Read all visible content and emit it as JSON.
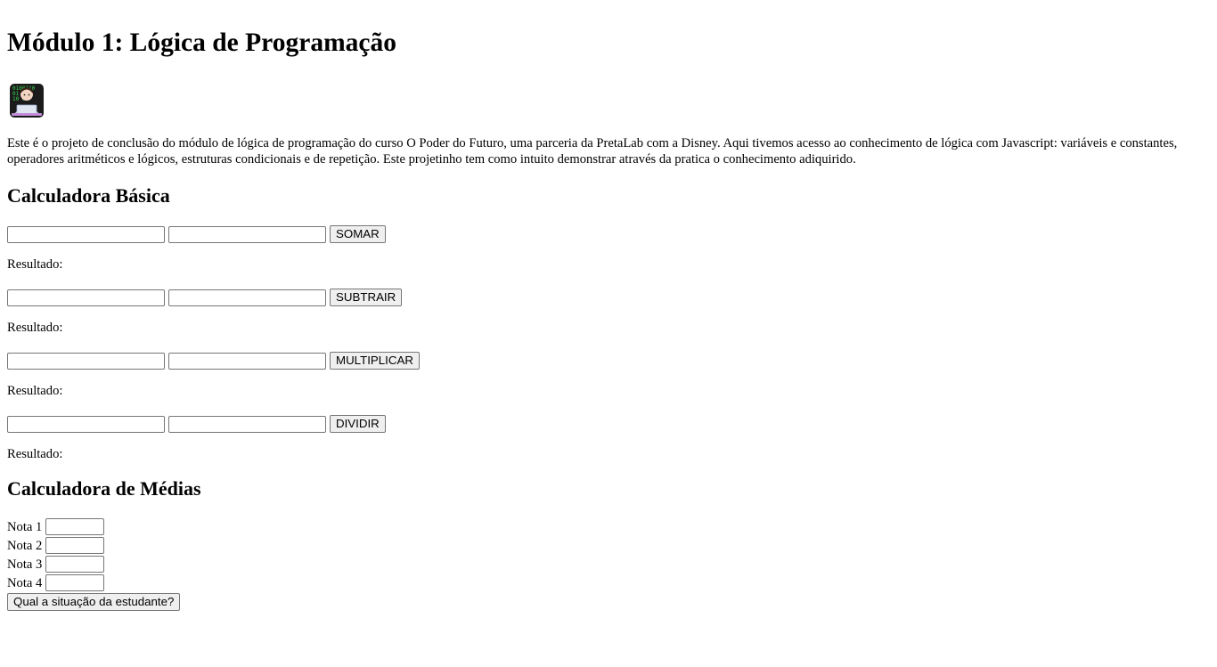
{
  "header": {
    "title": "Módulo 1: Lógica de Programação"
  },
  "logo": {
    "icon": "programmer-emoji-icon"
  },
  "intro": "Este é o projeto de conclusão do módulo de lógica de programação do curso O Poder do Futuro, uma parceria da PretaLab com a Disney. Aqui tivemos acesso ao conhecimento de lógica com Javascript: variáveis e constantes, operadores aritméticos e lógicos, estruturas condicionais e de repetição. Este projetinho tem como intuito demonstrar através da pratica o conhecimento adiquirido.",
  "calculator": {
    "title": "Calculadora Básica",
    "result_label": "Resultado:",
    "operations": [
      {
        "button": "SOMAR",
        "value_a": "",
        "value_b": ""
      },
      {
        "button": "SUBTRAIR",
        "value_a": "",
        "value_b": ""
      },
      {
        "button": "MULTIPLICAR",
        "value_a": "",
        "value_b": ""
      },
      {
        "button": "DIVIDIR",
        "value_a": "",
        "value_b": ""
      }
    ]
  },
  "averages": {
    "title": "Calculadora de Médias",
    "grades": [
      {
        "label": "Nota 1",
        "value": ""
      },
      {
        "label": "Nota 2",
        "value": ""
      },
      {
        "label": "Nota 3",
        "value": ""
      },
      {
        "label": "Nota 4",
        "value": ""
      }
    ],
    "button": "Qual a situação da estudante?"
  }
}
